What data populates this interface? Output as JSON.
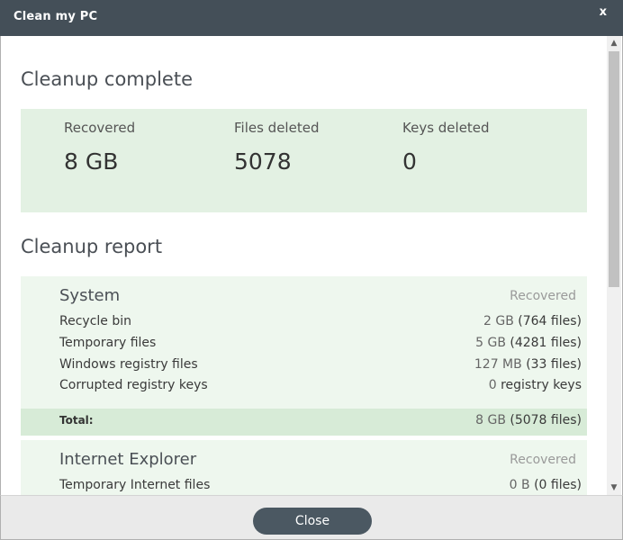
{
  "window": {
    "title": "Clean my PC",
    "close_glyph": "x"
  },
  "summary": {
    "heading": "Cleanup complete",
    "stats": [
      {
        "label": "Recovered",
        "value": "8 GB"
      },
      {
        "label": "Files deleted",
        "value": "5078"
      },
      {
        "label": "Keys deleted",
        "value": "0"
      }
    ]
  },
  "report": {
    "heading": "Cleanup report",
    "sections": [
      {
        "title": "System",
        "recovered_label": "Recovered",
        "rows": [
          {
            "label": "Recycle bin",
            "size": "2 GB",
            "detail": "(764 files)"
          },
          {
            "label": "Temporary files",
            "size": "5 GB",
            "detail": "(4281 files)"
          },
          {
            "label": "Windows registry files",
            "size": "127 MB",
            "detail": "(33 files)"
          },
          {
            "label": "Corrupted registry keys",
            "size": "0",
            "detail": "registry keys"
          }
        ],
        "total_label": "Total:",
        "total_size": "8 GB",
        "total_detail": "(5078 files)"
      },
      {
        "title": "Internet Explorer",
        "recovered_label": "Recovered",
        "rows": [
          {
            "label": "Temporary Internet files",
            "size": "0 B",
            "detail": "(0 files)"
          }
        ]
      }
    ]
  },
  "footer": {
    "close_label": "Close"
  },
  "scrollbar": {
    "up_icon": "▲",
    "down_icon": "▼"
  }
}
